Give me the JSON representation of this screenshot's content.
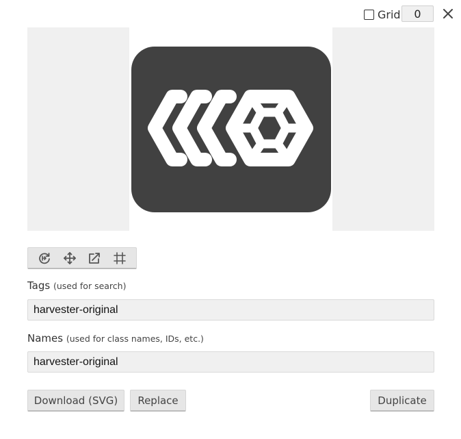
{
  "topbar": {
    "grid_label": "Grid",
    "grid_checked": false,
    "grid_value": "0",
    "close_icon": "close-icon"
  },
  "preview": {
    "icon_name": "harvester-icon",
    "icon_bg_color": "#414141",
    "side_color": "#f0f0f0"
  },
  "toolbar": {
    "tools": [
      "rotate-icon",
      "move-icon",
      "resize-icon",
      "crop-grid-icon"
    ]
  },
  "tags": {
    "label": "Tags",
    "hint": "(used for search)",
    "value": "harvester-original"
  },
  "names": {
    "label": "Names",
    "hint": "(used for class names, IDs, etc.)",
    "value": "harvester-original"
  },
  "actions": {
    "download_label": "Download (SVG)",
    "replace_label": "Replace",
    "duplicate_label": "Duplicate"
  }
}
